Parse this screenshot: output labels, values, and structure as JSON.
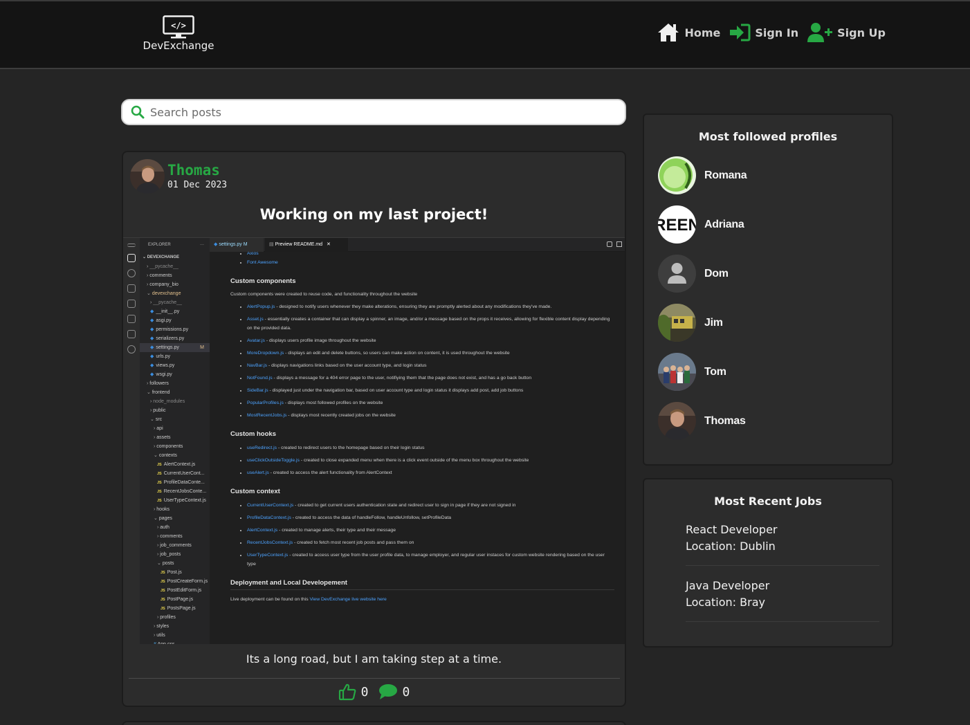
{
  "app": {
    "brand": "DevExchange",
    "logo_glyph": "</>"
  },
  "nav": {
    "home": "Home",
    "sign_in": "Sign In",
    "sign_up": "Sign Up"
  },
  "search": {
    "placeholder": "Search posts"
  },
  "post": {
    "author": "Thomas",
    "date": "01 Dec 2023",
    "title": "Working on my last project!",
    "body": "Its a long road, but I am taking step at a time.",
    "likes": "0",
    "comments": "0",
    "screenshot": {
      "explorer_header": "EXPLORER",
      "explorer_more": "···",
      "root": "DEVEXCHANGE",
      "modified_marker": "M",
      "tree": [
        {
          "label": "__pycache__",
          "kind": "dir",
          "depth": 0
        },
        {
          "label": "comments",
          "kind": "dir",
          "depth": 0
        },
        {
          "label": "company_bio",
          "kind": "dir",
          "depth": 0
        },
        {
          "label": "devexchange",
          "kind": "open",
          "depth": 0
        },
        {
          "label": "__pycache__",
          "kind": "dir",
          "depth": 1
        },
        {
          "label": "__init__.py",
          "kind": "py",
          "depth": 1
        },
        {
          "label": "asgi.py",
          "kind": "py",
          "depth": 1
        },
        {
          "label": "permissions.py",
          "kind": "py",
          "depth": 1
        },
        {
          "label": "serializers.py",
          "kind": "py",
          "depth": 1
        },
        {
          "label": "settings.py",
          "kind": "py",
          "depth": 1
        },
        {
          "label": "urls.py",
          "kind": "py",
          "depth": 1
        },
        {
          "label": "views.py",
          "kind": "py",
          "depth": 1
        },
        {
          "label": "wsgi.py",
          "kind": "py",
          "depth": 1
        },
        {
          "label": "followers",
          "kind": "dir",
          "depth": 0
        },
        {
          "label": "frontend",
          "kind": "open",
          "depth": 0
        },
        {
          "label": "node_modules",
          "kind": "dir",
          "depth": 1
        },
        {
          "label": "public",
          "kind": "dir",
          "depth": 1
        },
        {
          "label": "src",
          "kind": "open",
          "depth": 1
        },
        {
          "label": "api",
          "kind": "dir",
          "depth": 2
        },
        {
          "label": "assets",
          "kind": "dir",
          "depth": 2
        },
        {
          "label": "components",
          "kind": "dir",
          "depth": 2
        },
        {
          "label": "contexts",
          "kind": "open",
          "depth": 2
        },
        {
          "label": "AlertContext.js",
          "kind": "js",
          "depth": 3
        },
        {
          "label": "CurrentUserCont...",
          "kind": "js",
          "depth": 3
        },
        {
          "label": "ProfileDataConte...",
          "kind": "js",
          "depth": 3
        },
        {
          "label": "RecentJobsConte...",
          "kind": "js",
          "depth": 3
        },
        {
          "label": "UserTypeContext.js",
          "kind": "js",
          "depth": 3
        },
        {
          "label": "hooks",
          "kind": "dir",
          "depth": 2
        },
        {
          "label": "pages",
          "kind": "open",
          "depth": 2
        },
        {
          "label": "auth",
          "kind": "dir",
          "depth": 3
        },
        {
          "label": "comments",
          "kind": "dir",
          "depth": 3
        },
        {
          "label": "job_comments",
          "kind": "dir",
          "depth": 3
        },
        {
          "label": "job_posts",
          "kind": "dir",
          "depth": 3
        },
        {
          "label": "posts",
          "kind": "open",
          "depth": 3
        },
        {
          "label": "Post.js",
          "kind": "js",
          "depth": 4
        },
        {
          "label": "PostCreateForm.js",
          "kind": "js",
          "depth": 4
        },
        {
          "label": "PostEditForm.js",
          "kind": "js",
          "depth": 4
        },
        {
          "label": "PostPage.js",
          "kind": "js",
          "depth": 4
        },
        {
          "label": "PostsPage.js",
          "kind": "js",
          "depth": 4
        },
        {
          "label": "profiles",
          "kind": "dir",
          "depth": 3
        },
        {
          "label": "styles",
          "kind": "dir",
          "depth": 2
        },
        {
          "label": "utils",
          "kind": "dir",
          "depth": 2
        },
        {
          "label": "App.css",
          "kind": "css",
          "depth": 2
        }
      ],
      "tab_settings": "settings.py M",
      "tab_preview": "Preview README.md",
      "top_links": [
        "Axios",
        "Font Awesome"
      ],
      "sections": [
        {
          "heading": "Custom components",
          "intro": "Custom components were created to reuse code, and functionality throughout the website",
          "items": [
            {
              "link": "AlertPopup.js",
              "text": " - designed to notify users whenever they make alterations, ensuring they are promptly alerted about any modifications they've made."
            },
            {
              "link": "Asset.js",
              "text": " - essentially creates a container that can display a spinner, an image, and/or a message based on the props it receives, allowing for flexible content display depending on the provided data."
            },
            {
              "link": "Avatar.js",
              "text": " - displays users profile image throughout the website"
            },
            {
              "link": "MoreDropdown.js",
              "text": " - displays an edit and delete buttons, so users can make action on content, it is used throughout the website"
            },
            {
              "link": "NavBar.js",
              "text": " - displays navigations links based on the user account type, and login status"
            },
            {
              "link": "NotFound.js",
              "text": " - displays a message for a 404 error page to the user, notifiying them that the page does not exist, and has a go back button"
            },
            {
              "link": "SideBar.js",
              "text": " - displayed just under the navigation bar, based on user account type and login status it displays add post, add job buttons"
            },
            {
              "link": "PopularProfiles.js",
              "text": " - displays most followed profiles on the website"
            },
            {
              "link": "MostRecentJobs.js",
              "text": " - displays most recently created jobs on the website"
            }
          ]
        },
        {
          "heading": "Custom hooks",
          "intro": "",
          "items": [
            {
              "link": "useRedirect.js",
              "text": " - created to redirect users to the homepage based on their login status"
            },
            {
              "link": "useClickOutsideToggle.js",
              "text": " - created to close expanded menu when there is a click event outside of the menu box throughout the website"
            },
            {
              "link": "useAlert.js",
              "text": " - created to access the alert functionality from AlertContext"
            }
          ]
        },
        {
          "heading": "Custom context",
          "intro": "",
          "items": [
            {
              "link": "CurrentUserContext.js",
              "text": " - created to get current users authentication state and redirect user to sign in page if they are not signed in"
            },
            {
              "link": "ProfileDataContext.js",
              "text": " - created to access the data of handleFollow, handleUnfollow, setProfileData"
            },
            {
              "link": "AlertContext.js",
              "text": " - created to manage alerts, their type and their message"
            },
            {
              "link": "RecentJobsContext.js",
              "text": " - created to fetch most recent job posts and pass them on"
            },
            {
              "link": "UserTypeContext.js",
              "text": " - created to access user type from the user profile data, to manage employer, and regular user instaces for custom website rendering based on the user type"
            }
          ]
        }
      ],
      "deploy_heading": "Deployment and Local Developement",
      "deploy_text": "Live deployment can be found on this ",
      "deploy_link": "View DevExchange live website here"
    }
  },
  "sidebar": {
    "profiles_title": "Most followed profiles",
    "profiles": [
      {
        "name": "Romana",
        "avatar": "planet-icon"
      },
      {
        "name": "Adriana",
        "avatar": "green-text-icon",
        "avatar_text": "REEN"
      },
      {
        "name": "Dom",
        "avatar": "default-user-icon"
      },
      {
        "name": "Jim",
        "avatar": "train-photo-icon"
      },
      {
        "name": "Tom",
        "avatar": "group-photo-icon"
      },
      {
        "name": "Thomas",
        "avatar": "portrait-photo-icon"
      }
    ],
    "jobs_title": "Most Recent Jobs",
    "jobs": [
      {
        "title": "React Developer",
        "location": "Location: Dublin"
      },
      {
        "title": "Java Developer",
        "location": "Location: Bray"
      }
    ]
  },
  "colors": {
    "accent_green": "#27a844",
    "background": "#252525",
    "topbar": "#141414",
    "card": "#2c2c2c",
    "link_blue": "#4da3ff"
  }
}
